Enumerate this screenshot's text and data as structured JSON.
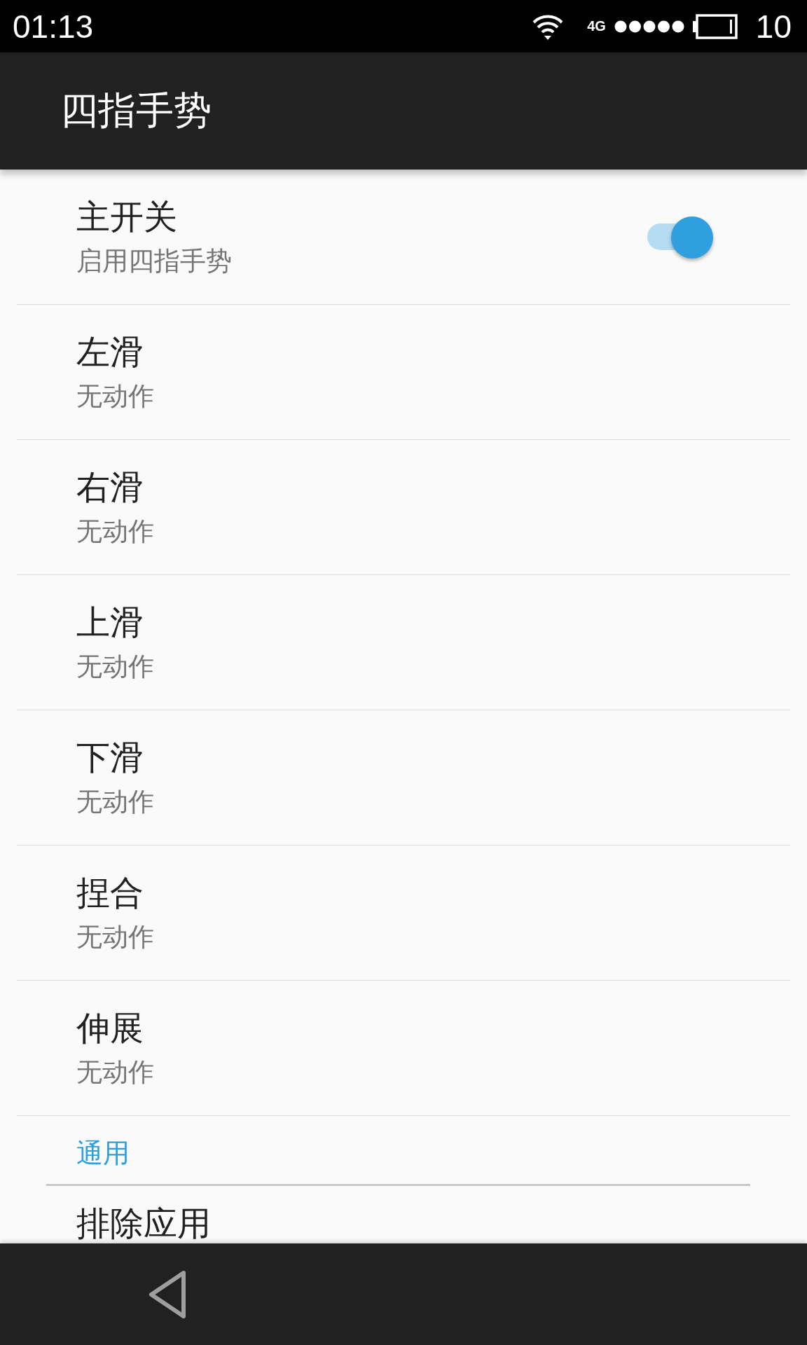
{
  "status_bar": {
    "time": "01:13",
    "network": "4G",
    "battery": "10"
  },
  "app_bar": {
    "title": "四指手势"
  },
  "settings": [
    {
      "kind": "switch",
      "title": "主开关",
      "summary": "启用四指手势",
      "on": true
    },
    {
      "kind": "item",
      "title": "左滑",
      "summary": "无动作"
    },
    {
      "kind": "item",
      "title": "右滑",
      "summary": "无动作"
    },
    {
      "kind": "item",
      "title": "上滑",
      "summary": "无动作"
    },
    {
      "kind": "item",
      "title": "下滑",
      "summary": "无动作"
    },
    {
      "kind": "item",
      "title": "捏合",
      "summary": "无动作"
    },
    {
      "kind": "item",
      "title": "伸展",
      "summary": "无动作"
    },
    {
      "kind": "header",
      "title": "通用"
    },
    {
      "kind": "item",
      "title": "排除应用"
    }
  ]
}
